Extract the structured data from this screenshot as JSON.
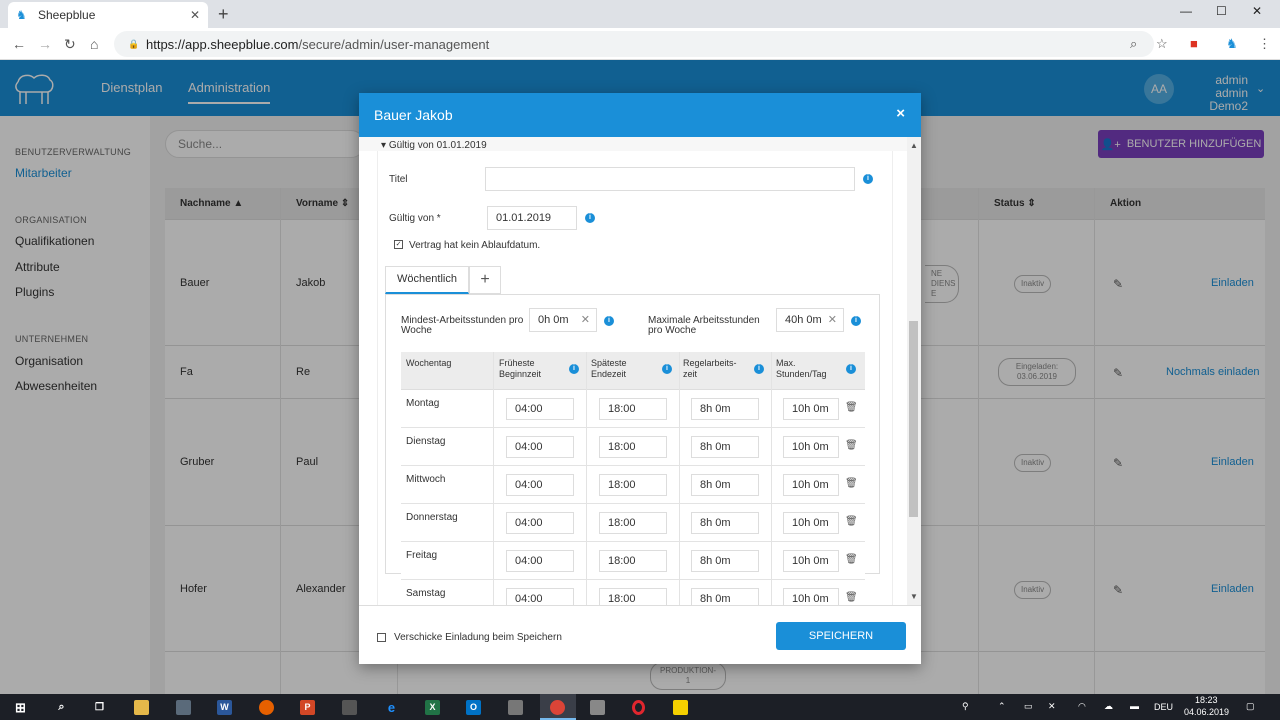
{
  "browser": {
    "tab_title": "Sheepblue",
    "new_tab": "+",
    "url_host": "https://app.sheepblue.com",
    "url_path": "/secure/admin/user-management",
    "minimize": "—",
    "maximize": "☐",
    "close": "✕"
  },
  "header": {
    "nav": [
      "Dienstplan",
      "Administration"
    ],
    "avatar_initials": "AA",
    "user_name": "admin admin",
    "user_org": "Demo2"
  },
  "sidebar": {
    "sections": [
      {
        "heading": "BENUTZERVERWALTUNG",
        "items": [
          "Mitarbeiter"
        ]
      },
      {
        "heading": "ORGANISATION",
        "items": [
          "Qualifikationen",
          "Attribute",
          "Plugins"
        ]
      },
      {
        "heading": "UNTERNEHMEN",
        "items": [
          "Organisation",
          "Abwesenheiten"
        ]
      }
    ]
  },
  "main": {
    "search_placeholder": "Suche...",
    "add_button": "BENUTZER HINZUFÜGEN",
    "columns": [
      "Nachname",
      "Vorname",
      "Status",
      "Aktion"
    ],
    "rows": [
      {
        "last": "Bauer",
        "first": "Jakob",
        "status": "Inaktiv",
        "action": "Einladen",
        "badge": "NE DIENS E"
      },
      {
        "last": "Fa",
        "first": "Re",
        "status": "Eingeladen: 03.06.2019",
        "action": "Nochmals einladen"
      },
      {
        "last": "Gruber",
        "first": "Paul",
        "status": "Inaktiv",
        "action": "Einladen"
      },
      {
        "last": "Hofer",
        "first": "Alexander",
        "status": "Inaktiv",
        "action": "Einladen"
      }
    ],
    "bottom_badge": "PRODUKTION- 1"
  },
  "modal": {
    "title": "Bauer Jakob",
    "close": "×",
    "section_title": "Gültig von 01.01.2019",
    "titel_label": "Titel",
    "titel_value": "",
    "valid_from_label": "Gültig von *",
    "valid_from_value": "01.01.2019",
    "no_expiry_label": "Vertrag hat kein Ablaufdatum.",
    "tab_weekly": "Wöchentlich",
    "tab_add": "+",
    "min_hours_label": "Mindest-Arbeitsstunden pro Woche",
    "min_hours_value": "0h 0m",
    "max_hours_label": "Maximale Arbeitsstunden pro Woche",
    "max_hours_value": "40h 0m",
    "week_headers": [
      "Wochentag",
      "Früheste Beginnzeit",
      "Späteste Endezeit",
      "Regelarbeits-zeit",
      "Max. Stunden/Tag"
    ],
    "days": [
      {
        "day": "Montag",
        "start": "04:00",
        "end": "18:00",
        "regular": "8h 0m",
        "max": "10h 0m"
      },
      {
        "day": "Dienstag",
        "start": "04:00",
        "end": "18:00",
        "regular": "8h 0m",
        "max": "10h 0m"
      },
      {
        "day": "Mittwoch",
        "start": "04:00",
        "end": "18:00",
        "regular": "8h 0m",
        "max": "10h 0m"
      },
      {
        "day": "Donnerstag",
        "start": "04:00",
        "end": "18:00",
        "regular": "8h 0m",
        "max": "10h 0m"
      },
      {
        "day": "Freitag",
        "start": "04:00",
        "end": "18:00",
        "regular": "8h 0m",
        "max": "10h 0m"
      },
      {
        "day": "Samstag",
        "start": "04:00",
        "end": "18:00",
        "regular": "8h 0m",
        "max": "10h 0m"
      }
    ],
    "send_invite_label": "Verschicke Einladung beim Speichern",
    "save_button": "SPEICHERN"
  },
  "taskbar": {
    "lang": "DEU",
    "time": "18:23",
    "date": "04.06.2019"
  },
  "colors": {
    "brand": "#1a8fd8",
    "purple": "#7b3fbf"
  }
}
